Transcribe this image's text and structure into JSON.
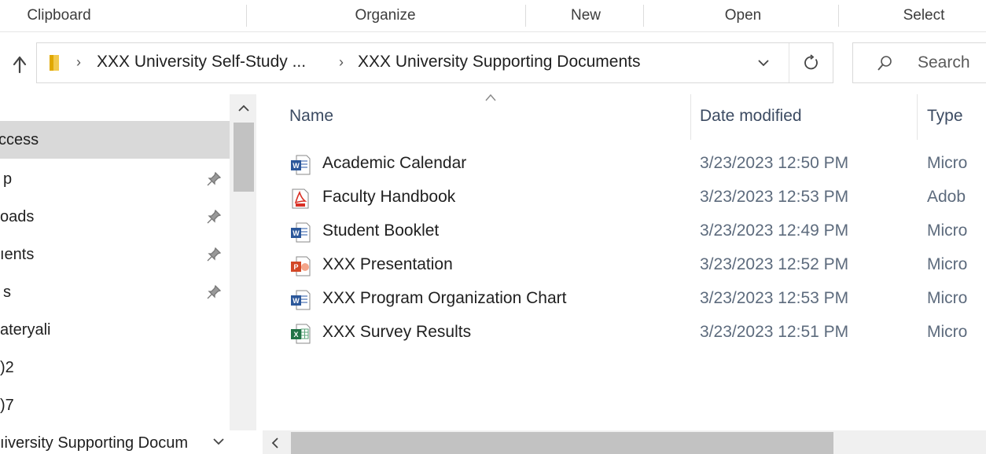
{
  "ribbon": {
    "groups": [
      "Clipboard",
      "Organize",
      "New",
      "Open",
      "Select"
    ]
  },
  "address": {
    "crumbs": [
      "XXX University Self-Study ...",
      "XXX University Supporting Documents"
    ],
    "search_placeholder": "Search"
  },
  "nav": {
    "items": [
      {
        "label": "ccess",
        "pinned": false,
        "selected": true
      },
      {
        "label": "p",
        "pinned": true,
        "selected": false
      },
      {
        "label": "oads",
        "pinned": true,
        "selected": false
      },
      {
        "label": "ıents",
        "pinned": true,
        "selected": false
      },
      {
        "label": "s",
        "pinned": true,
        "selected": false
      },
      {
        "label": "ateryali",
        "pinned": false,
        "selected": false
      },
      {
        "label": ")2",
        "pinned": false,
        "selected": false
      },
      {
        "label": ")7",
        "pinned": false,
        "selected": false
      },
      {
        "label": "ıiversity Supporting Docum",
        "pinned": false,
        "selected": false
      }
    ]
  },
  "columns": {
    "name": "Name",
    "date": "Date modified",
    "type": "Type"
  },
  "files": [
    {
      "name": "Academic Calendar",
      "date": "3/23/2023 12:50 PM",
      "type": "Micro",
      "icon": "word-icon"
    },
    {
      "name": "Faculty Handbook",
      "date": "3/23/2023 12:53 PM",
      "type": "Adob",
      "icon": "pdf-icon"
    },
    {
      "name": "Student Booklet",
      "date": "3/23/2023 12:49 PM",
      "type": "Micro",
      "icon": "word-icon"
    },
    {
      "name": "XXX Presentation",
      "date": "3/23/2023 12:52 PM",
      "type": "Micro",
      "icon": "powerpoint-icon"
    },
    {
      "name": "XXX Program Organization Chart",
      "date": "3/23/2023 12:53 PM",
      "type": "Micro",
      "icon": "word-icon"
    },
    {
      "name": "XXX Survey Results",
      "date": "3/23/2023 12:51 PM",
      "type": "Micro",
      "icon": "excel-icon"
    }
  ],
  "colors": {
    "word": "#2b579a",
    "pdf": "#d93025",
    "powerpoint": "#d24726",
    "excel": "#217346",
    "folder": "#f2c94c",
    "selection": "#d9d9d9"
  }
}
